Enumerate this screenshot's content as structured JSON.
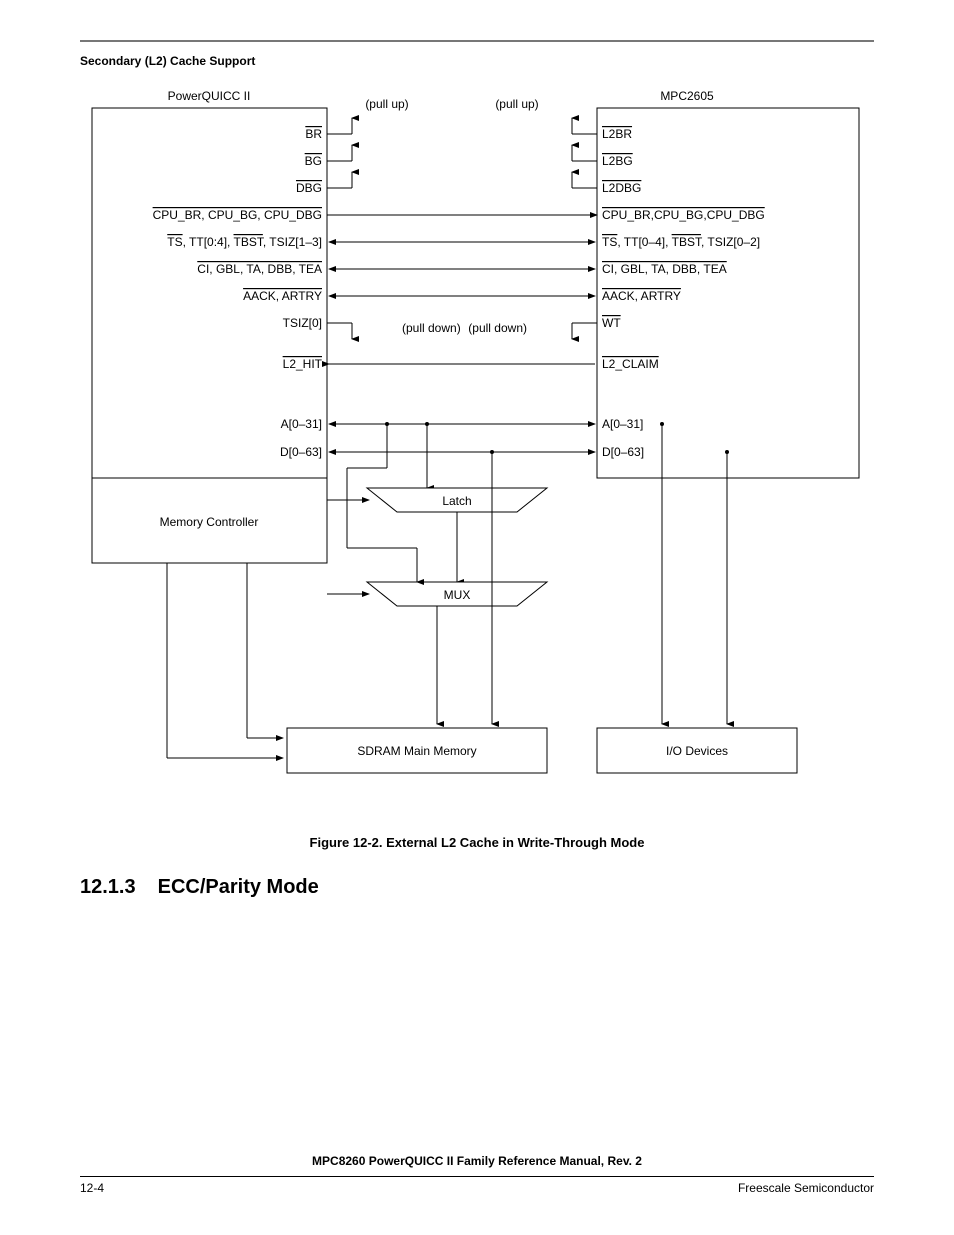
{
  "header": {
    "section_title": "Secondary (L2) Cache Support"
  },
  "diagram": {
    "left_block_title": "PowerQUICC II",
    "right_block_title": "MPC2605",
    "pull_up_label_left": "(pull up)",
    "pull_up_label_right": "(pull up)",
    "pull_down_label_left": "(pull down)",
    "pull_down_label_right": "(pull down)",
    "left_signals": {
      "s1": "BR",
      "s2": "BG",
      "s3": "DBG",
      "s4": "CPU_BR, CPU_BG, CPU_DBG",
      "s5": "TS, TT[0:4], TBST, TSIZ[1–3]",
      "s6": "CI, GBL, TA, DBB, TEA",
      "s7": "AACK, ARTRY",
      "s8": "TSIZ[0]",
      "s9": "L2_HIT",
      "s10": "A[0–31]",
      "s11": "D[0–63]"
    },
    "right_signals": {
      "s1": "L2BR",
      "s2": "L2BG",
      "s3": "L2DBG",
      "s4": "CPU_BR,CPU_BG,CPU_DBG",
      "s5": "TS, TT[0–4], TBST, TSIZ[0–2]",
      "s6": "CI, GBL, TA, DBB, TEA",
      "s7": "AACK, ARTRY",
      "s8": "WT",
      "s9": "L2_CLAIM",
      "s10": "A[0–31]",
      "s11": "D[0–63]"
    },
    "latch_label": "Latch",
    "mux_label": "MUX",
    "memory_controller_label": "Memory Controller",
    "sdram_label": "SDRAM Main Memory",
    "io_devices_label": "I/O Devices"
  },
  "figure_caption": "Figure 12-2. External L2 Cache in Write-Through Mode",
  "section_heading": {
    "number": "12.1.3",
    "text": "ECC/Parity Mode"
  },
  "footer": {
    "manual_title": "MPC8260 PowerQUICC II Family Reference Manual, Rev. 2",
    "page_number": "12-4",
    "company": "Freescale Semiconductor"
  }
}
